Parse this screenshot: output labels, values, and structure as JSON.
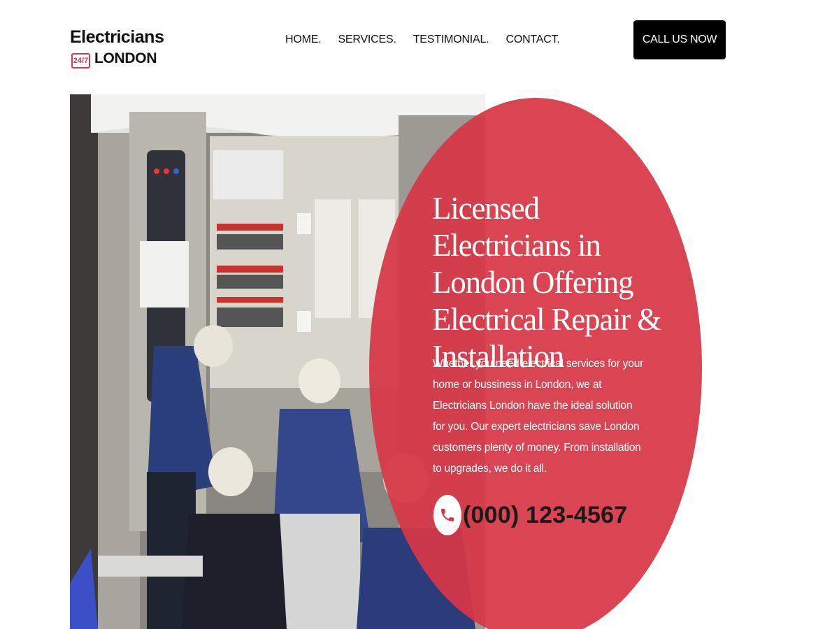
{
  "header": {
    "logo": {
      "line1": "Electricians",
      "badge": "24/7",
      "line2": "LONDON"
    },
    "nav": [
      {
        "label": "HOME."
      },
      {
        "label": "SERVICES."
      },
      {
        "label": "TESTIMONIAL."
      },
      {
        "label": "CONTACT."
      }
    ],
    "cta_label": "CALL US NOW"
  },
  "hero": {
    "headline": "Licensed Electricians in London Offering Electrical Repair & Installation",
    "intro": "Whether you need electrical services for your home or bussiness in London, we at Electricians London have the ideal solution for you. Our expert electricians save London customers plenty of money. From installation to upgrades, we do it all.",
    "phone": "(000) 123-4567",
    "phone_icon": "phone-icon",
    "image_icon": "electricians-at-panel-photo"
  },
  "colors": {
    "accent": "#d63746",
    "button": "#000000",
    "text": "#111111"
  }
}
